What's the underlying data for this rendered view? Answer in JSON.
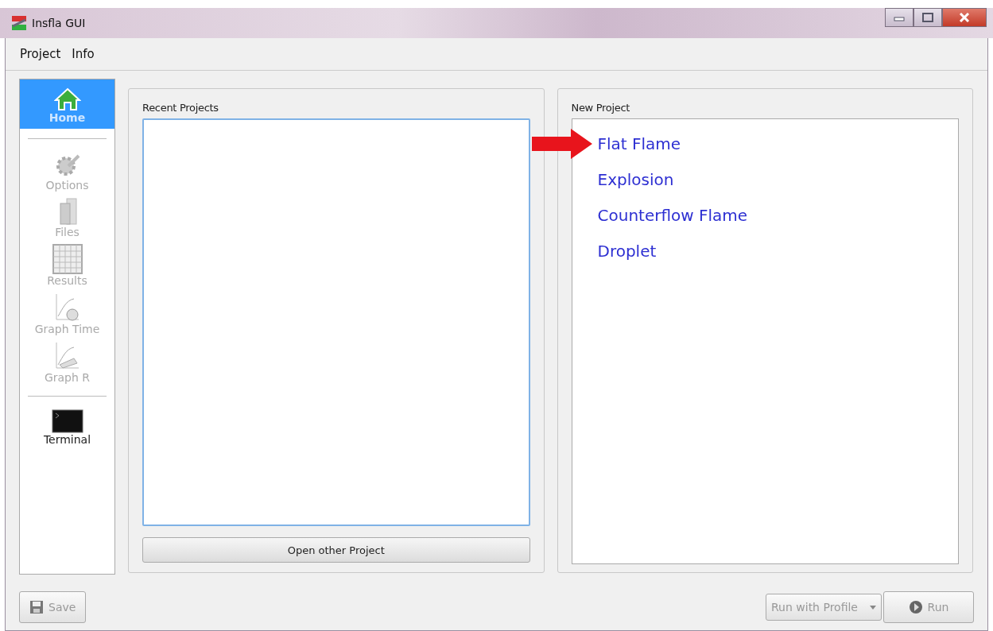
{
  "window": {
    "title": "Insfla GUI"
  },
  "menu": [
    "Project",
    "Info"
  ],
  "sidebar": {
    "groups": [
      [
        {
          "label": "Home",
          "kind": "home",
          "selected": true,
          "disabled": false
        }
      ],
      [
        {
          "label": "Options",
          "kind": "gear",
          "selected": false,
          "disabled": true
        },
        {
          "label": "Files",
          "kind": "files",
          "selected": false,
          "disabled": true
        },
        {
          "label": "Results",
          "kind": "grid",
          "selected": false,
          "disabled": true
        },
        {
          "label": "Graph Time",
          "kind": "clock",
          "selected": false,
          "disabled": true
        },
        {
          "label": "Graph R",
          "kind": "graph",
          "selected": false,
          "disabled": true
        }
      ],
      [
        {
          "label": "Terminal",
          "kind": "terminal",
          "selected": false,
          "disabled": false
        }
      ]
    ]
  },
  "recent_projects": {
    "title": "Recent Projects",
    "button": "Open other Project"
  },
  "new_project": {
    "title": "New Project",
    "items": [
      {
        "label": "Flat Flame",
        "pointed": true
      },
      {
        "label": "Explosion",
        "pointed": false
      },
      {
        "label": "Counterflow Flame",
        "pointed": false
      },
      {
        "label": "Droplet",
        "pointed": false
      }
    ]
  },
  "footer": {
    "save": {
      "label": "Save",
      "disabled": true
    },
    "profile": {
      "label": "Run with Profile",
      "disabled": true
    },
    "run": {
      "label": "Run",
      "disabled": true
    }
  }
}
